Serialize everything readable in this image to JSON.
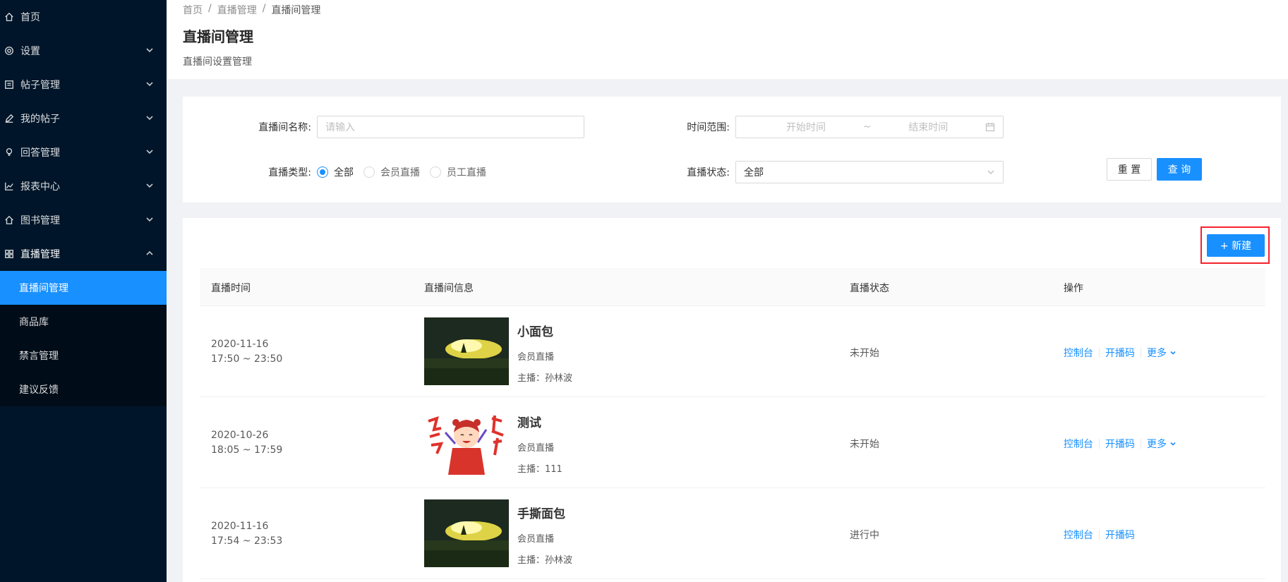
{
  "sidebar": {
    "items": [
      {
        "label": "首页",
        "icon": "home-icon"
      },
      {
        "label": "设置",
        "icon": "gear-icon"
      },
      {
        "label": "帖子管理",
        "icon": "list-icon"
      },
      {
        "label": "我的帖子",
        "icon": "pencil-icon"
      },
      {
        "label": "回答管理",
        "icon": "bulb-icon"
      },
      {
        "label": "报表中心",
        "icon": "chart-icon"
      },
      {
        "label": "图书管理",
        "icon": "home-icon"
      },
      {
        "label": "直播管理",
        "icon": "grid-icon"
      }
    ],
    "submenu": [
      {
        "label": "直播间管理",
        "active": true
      },
      {
        "label": "商品库"
      },
      {
        "label": "禁言管理"
      },
      {
        "label": "建议反馈"
      }
    ]
  },
  "breadcrumb": [
    "首页",
    "直播管理",
    "直播间管理"
  ],
  "breadcrumb_sep": "/",
  "page": {
    "title": "直播间管理",
    "description": "直播间设置管理"
  },
  "filter": {
    "name_label": "直播间名称:",
    "name_placeholder": "请输入",
    "time_label": "时间范围:",
    "time_start_placeholder": "开始时间",
    "time_sep": "~",
    "time_end_placeholder": "结束时间",
    "type_label": "直播类型:",
    "type_options": [
      "全部",
      "会员直播",
      "员工直播"
    ],
    "type_selected": "全部",
    "status_label": "直播状态:",
    "status_value": "全部",
    "reset_label": "重 置",
    "query_label": "查 询"
  },
  "new_button": "+ 新建",
  "table": {
    "columns": [
      "直播时间",
      "直播间信息",
      "直播状态",
      "操作"
    ],
    "rows": [
      {
        "date": "2020-11-16",
        "time": "17:50 ~ 23:50",
        "title": "小面包",
        "type": "会员直播",
        "host": "主播：孙林波",
        "status": "未开始",
        "ops": [
          "控制台",
          "开播码",
          "更多"
        ],
        "thumb": "landscape"
      },
      {
        "date": "2020-10-26",
        "time": "18:05 ~ 17:59",
        "title": "测试",
        "type": "会员直播",
        "host": "主播：111",
        "status": "未开始",
        "ops": [
          "控制台",
          "开播码",
          "更多"
        ],
        "thumb": "cartoon"
      },
      {
        "date": "2020-11-16",
        "time": "17:54 ~ 23:53",
        "title": "手撕面包",
        "type": "会员直播",
        "host": "主播：孙林波",
        "status": "进行中",
        "ops": [
          "控制台",
          "开播码"
        ],
        "thumb": "landscape"
      }
    ]
  },
  "colors": {
    "primary": "#1890ff",
    "sidebar": "#001529",
    "highlight": "#f5222d"
  }
}
